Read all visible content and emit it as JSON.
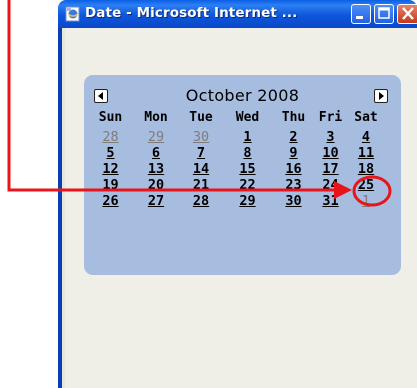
{
  "window": {
    "title": "Date - Microsoft Internet ..."
  },
  "calendar": {
    "month_label": "October 2008",
    "prev_icon": "left-arrow-icon",
    "next_icon": "right-arrow-icon",
    "day_headers": [
      "Sun",
      "Mon",
      "Tue",
      "Wed",
      "Thu",
      "Fri",
      "Sat"
    ],
    "weeks": [
      [
        "28",
        "29",
        "30",
        "1",
        "2",
        "3",
        "4"
      ],
      [
        "5",
        "6",
        "7",
        "8",
        "9",
        "10",
        "11"
      ],
      [
        "12",
        "13",
        "14",
        "15",
        "16",
        "17",
        "18"
      ],
      [
        "19",
        "20",
        "21",
        "22",
        "23",
        "24",
        "25"
      ],
      [
        "26",
        "27",
        "28",
        "29",
        "30",
        "31",
        "1"
      ]
    ],
    "other_month_cells": [
      "0-0",
      "0-1",
      "0-2",
      "4-6"
    ],
    "selected_cell": "2-6",
    "selected_day": "18"
  },
  "annotation": {
    "arrow_color": "#e8141a",
    "circle_color": "#e8141a"
  }
}
